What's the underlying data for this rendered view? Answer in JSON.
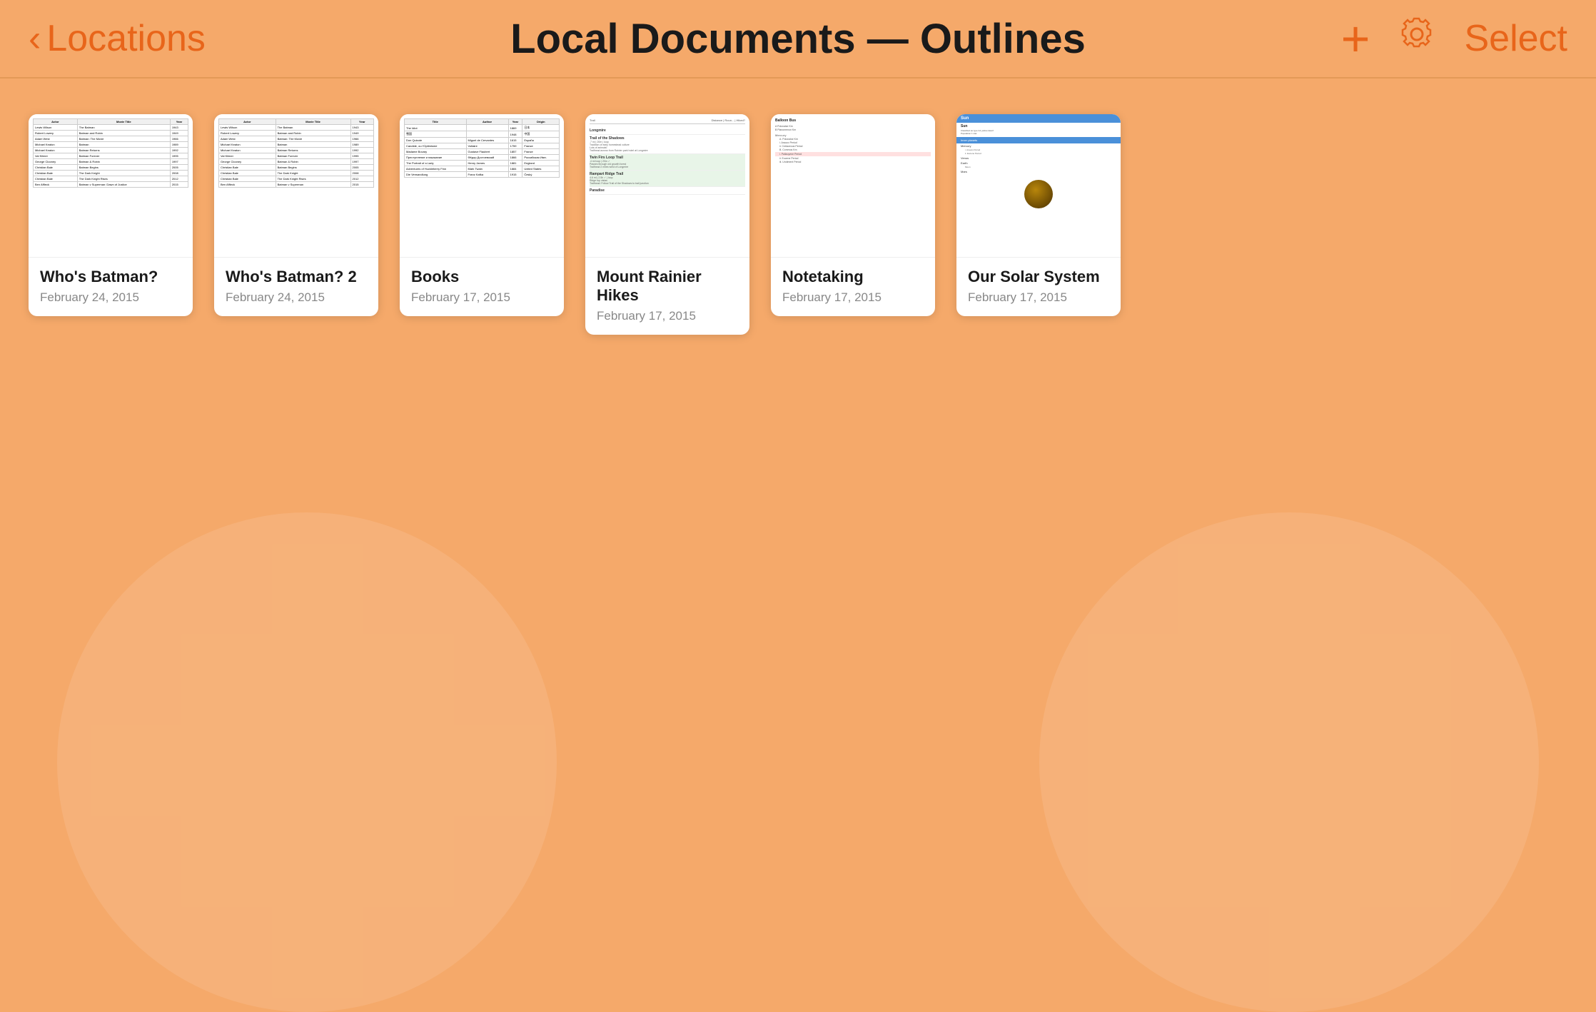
{
  "header": {
    "back_label": "Locations",
    "title": "Local Documents — Outlines",
    "add_label": "+",
    "select_label": "Select"
  },
  "documents": [
    {
      "id": "whats-batman-1",
      "title": "Who's Batman?",
      "date": "February 24, 2015",
      "type": "table"
    },
    {
      "id": "whats-batman-2",
      "title": "Who's Batman? 2",
      "date": "February 24, 2015",
      "type": "table"
    },
    {
      "id": "books",
      "title": "Books",
      "date": "February 17, 2015",
      "type": "books"
    },
    {
      "id": "mount-rainier",
      "title": "Mount Rainier Hikes",
      "date": "February 17, 2015",
      "type": "hikes"
    },
    {
      "id": "notetaking",
      "title": "Notetaking",
      "date": "February 17, 2015",
      "type": "notes"
    },
    {
      "id": "solar-system",
      "title": "Our Solar System",
      "date": "February 17, 2015",
      "type": "solar"
    }
  ]
}
